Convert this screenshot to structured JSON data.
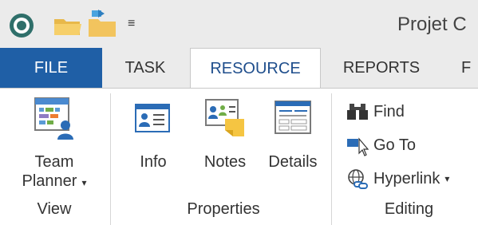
{
  "window": {
    "title": "Projet C",
    "qat_dropdown": "≡"
  },
  "tabs": [
    {
      "label": "FILE"
    },
    {
      "label": "TASK"
    },
    {
      "label": "RESOURCE"
    },
    {
      "label": "REPORTS"
    },
    {
      "label": "F"
    }
  ],
  "groups": {
    "view": {
      "label": "View",
      "team_planner": {
        "line1": "Team",
        "line2": "Planner",
        "caret": "▾"
      }
    },
    "properties": {
      "label": "Properties",
      "info": "Info",
      "notes": "Notes",
      "details": "Details"
    },
    "editing": {
      "label": "Editing",
      "find": "Find",
      "goto": "Go To",
      "hyperlink": "Hyperlink",
      "hyperlink_caret": "▾"
    }
  },
  "colors": {
    "file_tab": "#1f5fa6",
    "accent_blue": "#2b6cb6",
    "note_yellow": "#f5c542",
    "ribbon_bg": "#ebebeb"
  }
}
